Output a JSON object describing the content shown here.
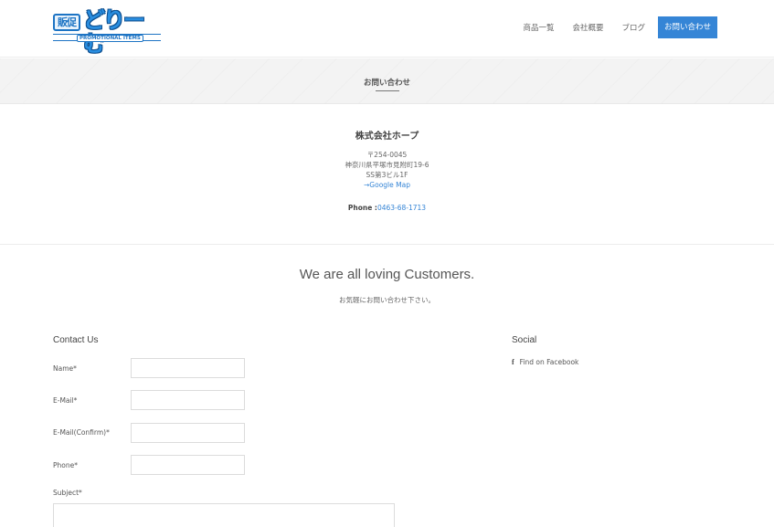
{
  "header": {
    "logo": {
      "badge": "販促",
      "main": "どりーむ",
      "sub": "PROMOTIONAL ITEMS"
    },
    "nav": [
      {
        "label": "商品一覧"
      },
      {
        "label": "会社概要"
      },
      {
        "label": "ブログ"
      }
    ],
    "cta_label": "お問い合わせ"
  },
  "title_band": {
    "title": "お問い合わせ"
  },
  "company": {
    "name": "株式会社ホープ",
    "postal": "〒254-0045",
    "address1": "神奈川県平塚市見附町19-6",
    "address2": "SS第3ビル1F",
    "map_link": "→Google Map",
    "phone_label": "Phone :",
    "phone_value": "0463-68-1713"
  },
  "tagline": {
    "main": "We are all loving Customers.",
    "sub": "お気軽にお問い合わせ下さい。"
  },
  "contact": {
    "heading": "Contact Us",
    "fields": {
      "name": "Name*",
      "email": "E-Mail*",
      "email_confirm": "E-Mail(Confirm)*",
      "phone": "Phone*",
      "subject": "Subject*"
    }
  },
  "social": {
    "heading": "Social",
    "facebook_icon": "f",
    "facebook_label": "Find on Facebook"
  }
}
